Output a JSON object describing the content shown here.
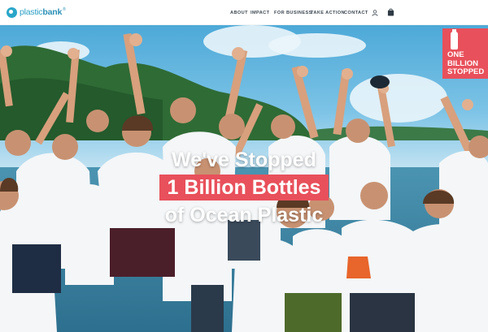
{
  "header": {
    "logo": {
      "part1": "plastic",
      "part2": "bank",
      "registered": "®"
    },
    "nav": [
      {
        "key": "about",
        "label": "ABOUT"
      },
      {
        "key": "impact",
        "label": "IMPACT"
      },
      {
        "key": "business",
        "label": "FOR BUSINESS"
      },
      {
        "key": "action",
        "label": "TAKE ACTION"
      },
      {
        "key": "contact",
        "label": "CONTACT"
      }
    ],
    "icons": [
      "user-icon",
      "shopping-bag-icon"
    ]
  },
  "hero": {
    "headline": {
      "line1": "We've Stopped",
      "line2": "1 Billion Bottles",
      "line3": "of Ocean Plastic"
    },
    "badge": {
      "line1": "ONE",
      "line2": "BILLION",
      "line3": "STOPPED"
    }
  },
  "colors": {
    "brand_blue": "#2a8fb7",
    "accent_red": "#e8505b",
    "nav_text": "#3d4853"
  }
}
